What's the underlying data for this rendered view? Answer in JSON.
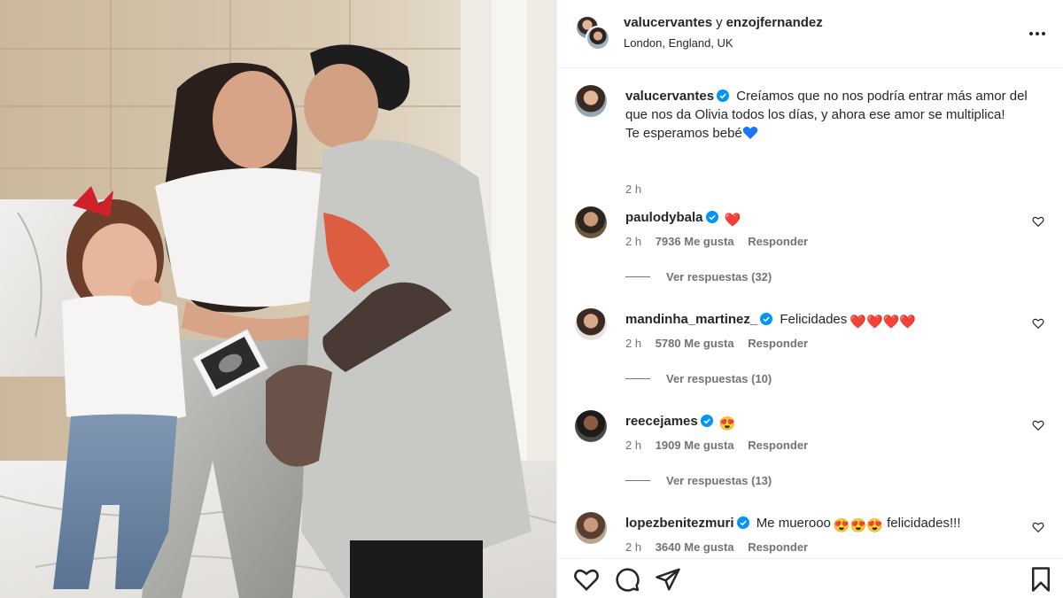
{
  "post": {
    "authors": [
      "valucervantes",
      "enzojfernandez"
    ],
    "author_joiner": "y",
    "location": "London, England, UK"
  },
  "caption": {
    "username": "valucervantes",
    "text": "Creíamos que no nos podría entrar más amor del que nos da Olivia todos los días, y ahora ese amor se multiplica!",
    "text_line2": "Te esperamos bebé",
    "time": "2 h"
  },
  "comments": [
    {
      "username": "paulodybala",
      "text": "",
      "emoji": "❤️",
      "time": "2 h",
      "likes": "7936 Me gusta",
      "reply": "Responder",
      "replies": "Ver respuestas (32)"
    },
    {
      "username": "mandinha_martinez_",
      "text": "Felicidades",
      "emoji": "❤️❤️❤️❤️",
      "time": "2 h",
      "likes": "5780 Me gusta",
      "reply": "Responder",
      "replies": "Ver respuestas (10)"
    },
    {
      "username": "reecejames",
      "text": "",
      "emoji": "😍",
      "time": "2 h",
      "likes": "1909 Me gusta",
      "reply": "Responder",
      "replies": "Ver respuestas (13)"
    },
    {
      "username": "lopezbenitezmuri",
      "text": "Me muerooo",
      "emoji": "😍😍😍",
      "text_after": "felicidades!!!",
      "time": "2 h",
      "likes": "3640 Me gusta",
      "reply": "Responder"
    }
  ],
  "icons": {
    "verified": "verified-badge-icon",
    "like": "heart-icon",
    "comment": "comment-icon",
    "share": "send-icon",
    "save": "bookmark-icon",
    "more": "more-options-icon"
  },
  "colors": {
    "verified": "#0095f6",
    "heart_red": "#e0245e",
    "blue_heart": "#1877f2",
    "text": "#262626",
    "secondary": "#737373"
  }
}
